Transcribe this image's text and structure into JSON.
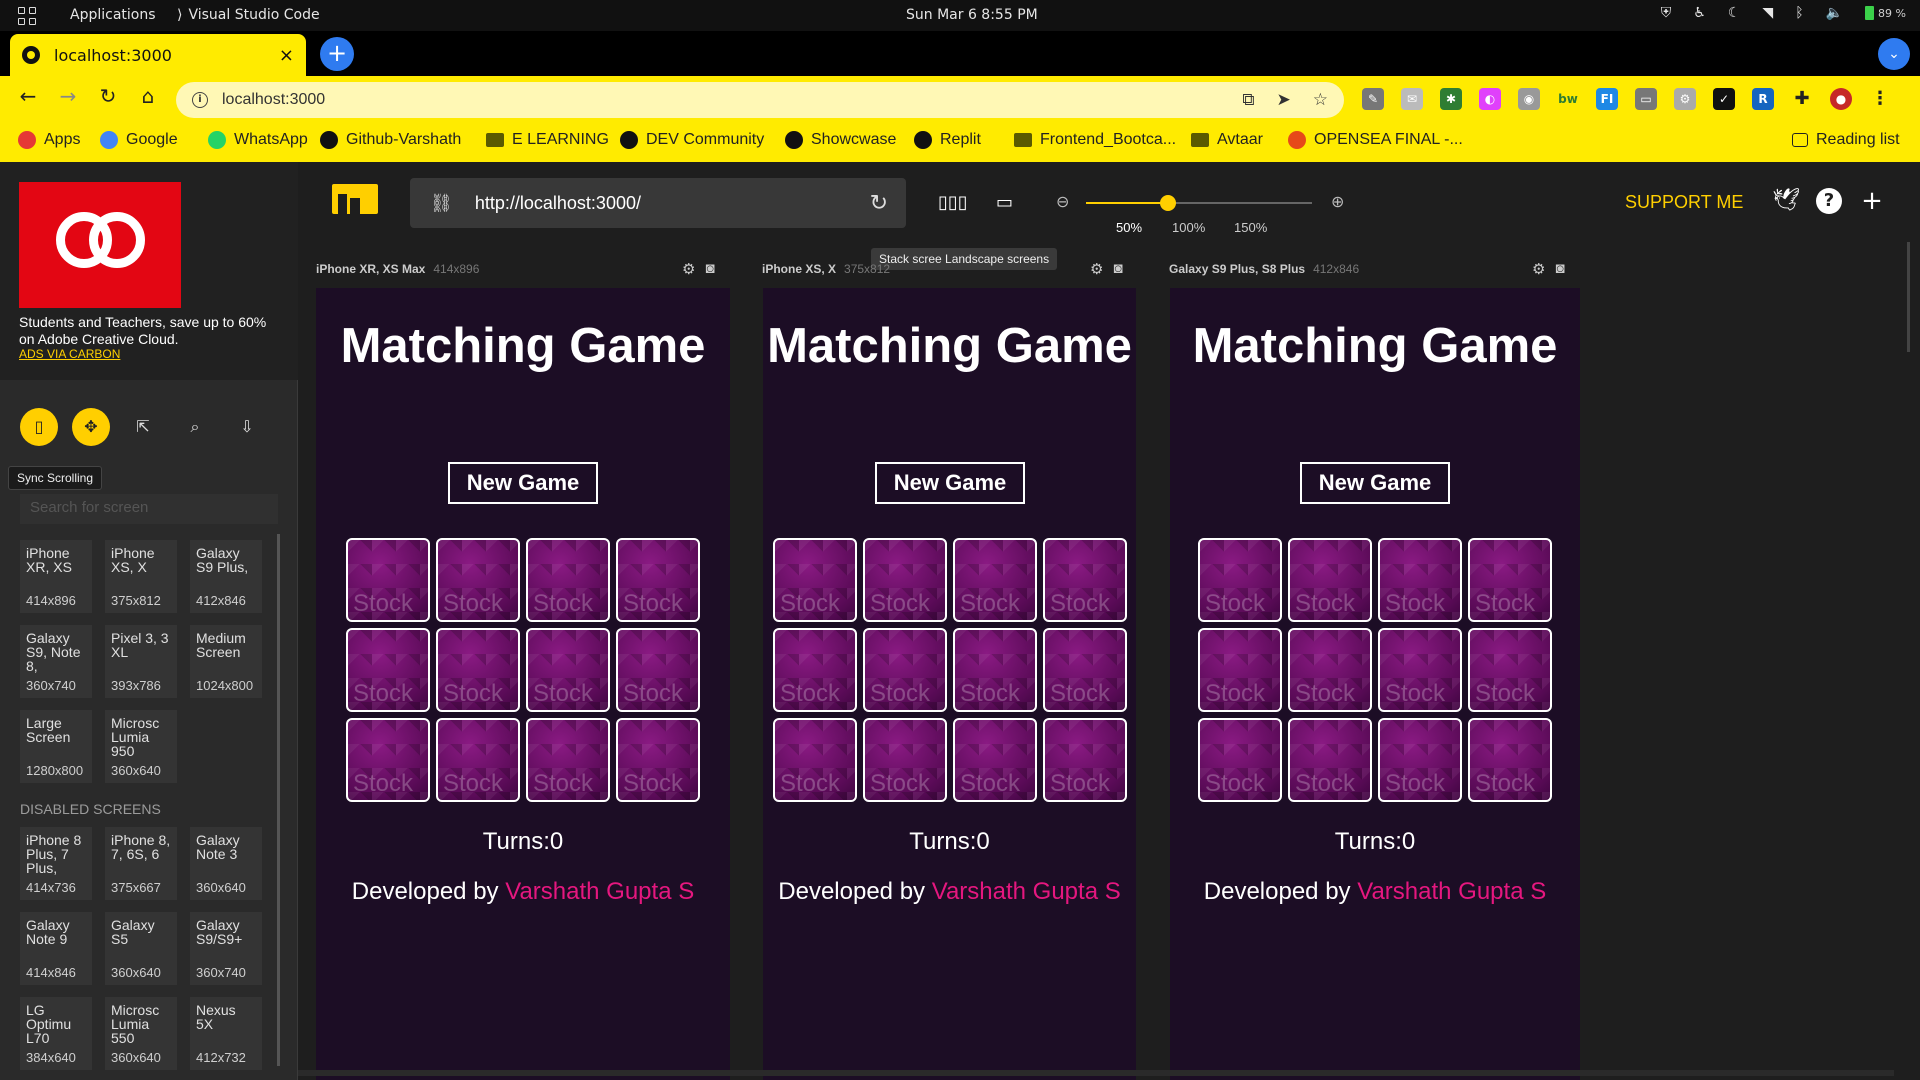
{
  "os": {
    "apps_label": "Applications",
    "active_app": "Visual Studio Code",
    "clock": "Sun Mar 6   8:55 PM",
    "battery": "89 %"
  },
  "browser": {
    "tab_title": "localhost:3000",
    "tab_close": "×",
    "new_tab": "+",
    "url": "localhost:3000",
    "bookmarks": [
      {
        "label": "Apps",
        "color": "#e53935"
      },
      {
        "label": "Google",
        "color": "#4285f4"
      },
      {
        "label": "WhatsApp",
        "color": "#25d366"
      },
      {
        "label": "Github-Varshath",
        "color": "#111111"
      },
      {
        "label": "E LEARNING",
        "color": "#5a5a00"
      },
      {
        "label": "DEV Community",
        "color": "#111111"
      },
      {
        "label": "Showcwase",
        "color": "#111111"
      },
      {
        "label": "Replit",
        "color": "#111111"
      },
      {
        "label": "Frontend_Bootca...",
        "color": "#5a5a00"
      },
      {
        "label": "Avtaar",
        "color": "#5a5a00"
      },
      {
        "label": "OPENSEA FINAL -...",
        "color": "#e64a19"
      }
    ],
    "reading_list": "Reading list"
  },
  "ad": {
    "text": "Students and Teachers, save up to 60% on Adobe Creative Cloud.",
    "link": "ADS VIA CARBON"
  },
  "sidebar": {
    "tooltip": "Sync Scrolling",
    "search_placeholder": "Search for screen",
    "devices": [
      {
        "name": "iPhone XR, XS",
        "size": "414x896"
      },
      {
        "name": "iPhone XS, X",
        "size": "375x812"
      },
      {
        "name": "Galaxy S9 Plus,",
        "size": "412x846"
      },
      {
        "name": "Galaxy S9, Note 8,",
        "size": "360x740"
      },
      {
        "name": "Pixel 3, 3 XL",
        "size": "393x786"
      },
      {
        "name": "Medium Screen",
        "size": "1024x800"
      },
      {
        "name": "Large Screen",
        "size": "1280x800"
      },
      {
        "name": "Microsc Lumia 950",
        "size": "360x640"
      }
    ],
    "disabled_label": "DISABLED SCREENS",
    "disabled_devices": [
      {
        "name": "iPhone 8 Plus, 7 Plus,",
        "size": "414x736"
      },
      {
        "name": "iPhone 8, 7, 6S, 6",
        "size": "375x667"
      },
      {
        "name": "Galaxy Note 3",
        "size": "360x640"
      },
      {
        "name": "Galaxy Note 9",
        "size": "414x846"
      },
      {
        "name": "Galaxy S5",
        "size": "360x640"
      },
      {
        "name": "Galaxy S9/S9+",
        "size": "360x740"
      },
      {
        "name": "LG Optimu L70",
        "size": "384x640"
      },
      {
        "name": "Microsc Lumia 550",
        "size": "360x640"
      },
      {
        "name": "Nexus 5X",
        "size": "412x732"
      }
    ]
  },
  "toolbar": {
    "address": "http://localhost:3000/",
    "zoom_labels": [
      "50%",
      "100%",
      "150%"
    ],
    "zoom_value": 0.5,
    "support": "SUPPORT ME",
    "tooltip": "Stack scree   Landscape screens"
  },
  "screens": [
    {
      "name": "iPhone XR, XS Max",
      "size": "414x896"
    },
    {
      "name": "iPhone XS, X",
      "size": "375x812"
    },
    {
      "name": "Galaxy S9 Plus, S8 Plus",
      "size": "412x846"
    }
  ],
  "app": {
    "title": "Matching Game",
    "button": "New Game",
    "card_text": "Stock",
    "turns": "Turns:0",
    "dev_prefix": "Developed by ",
    "dev_name": "Varshath Gupta S"
  }
}
